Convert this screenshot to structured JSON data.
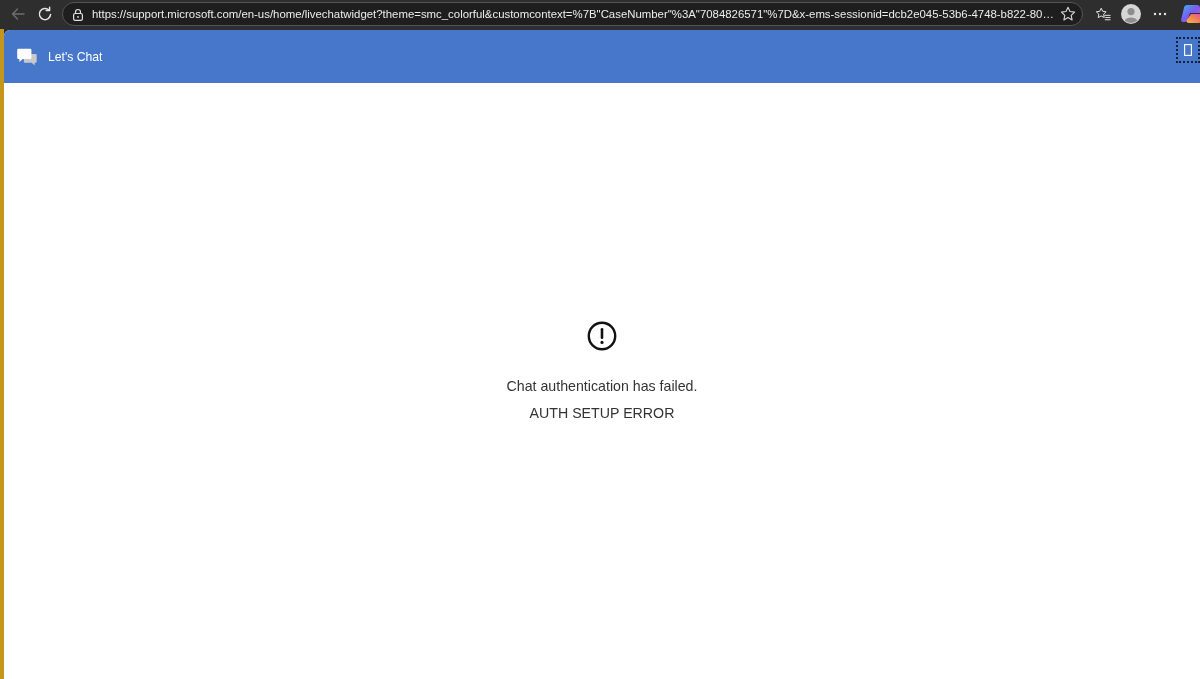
{
  "browser": {
    "back_button": {
      "disabled": true
    },
    "address_bar": {
      "url": "https://support.microsoft.com/en-us/home/livechatwidget?theme=smc_colorful&customcontext=%7B\"CaseNumber\"%3A\"7084826571\"%7D&x-ems-sessionid=dcb2e045-53b6-4748-b822-80…"
    }
  },
  "chat_header": {
    "title": "Let's Chat",
    "action_button": {
      "focused": true
    }
  },
  "error": {
    "message": "Chat authentication has failed.",
    "code": "AUTH SETUP ERROR"
  }
}
